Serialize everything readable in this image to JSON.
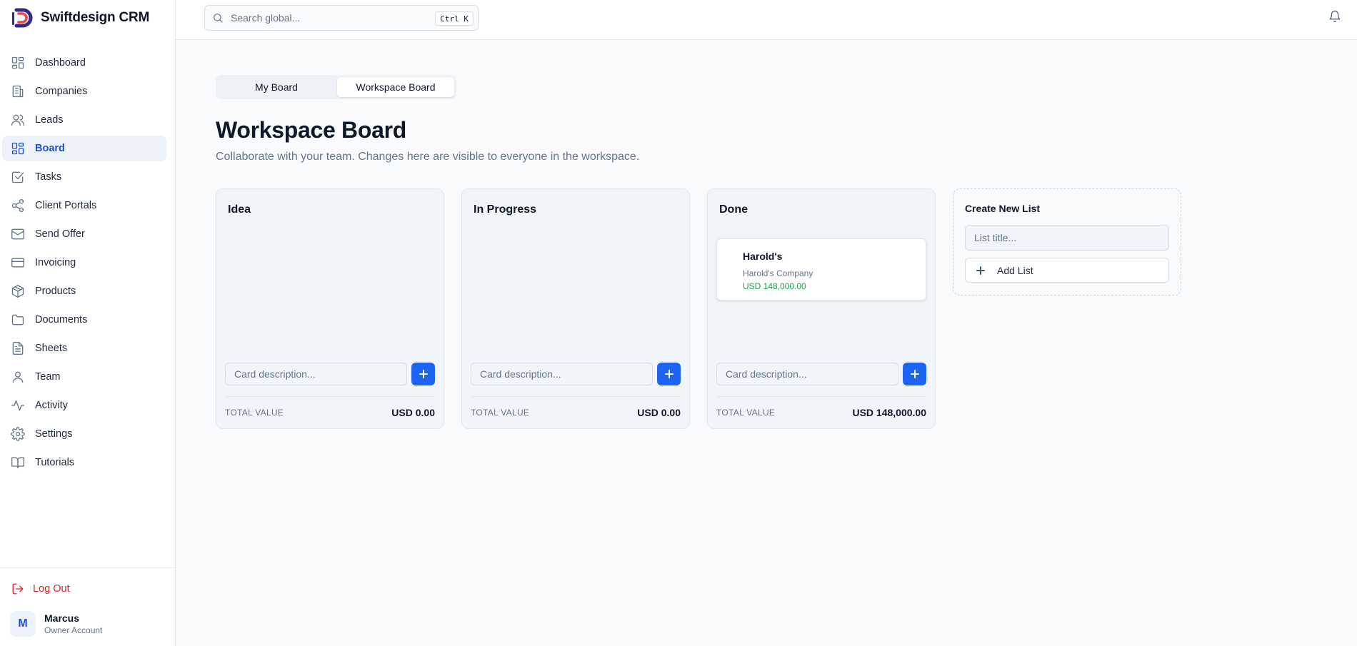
{
  "app": {
    "name": "Swiftdesign CRM",
    "accent": "#1d4ed8",
    "button_color": "#1d64f2"
  },
  "sidebar": {
    "items": [
      {
        "label": "Dashboard",
        "icon": "dashboard-icon"
      },
      {
        "label": "Companies",
        "icon": "building-icon"
      },
      {
        "label": "Leads",
        "icon": "users-icon"
      },
      {
        "label": "Board",
        "icon": "board-icon",
        "active": true
      },
      {
        "label": "Tasks",
        "icon": "checkbox-icon"
      },
      {
        "label": "Client Portals",
        "icon": "share-icon"
      },
      {
        "label": "Send Offer",
        "icon": "mail-icon"
      },
      {
        "label": "Invoicing",
        "icon": "credit-card-icon"
      },
      {
        "label": "Products",
        "icon": "package-icon"
      },
      {
        "label": "Documents",
        "icon": "folder-icon"
      },
      {
        "label": "Sheets",
        "icon": "file-text-icon"
      },
      {
        "label": "Team",
        "icon": "user-icon"
      },
      {
        "label": "Activity",
        "icon": "activity-icon"
      },
      {
        "label": "Settings",
        "icon": "gear-icon"
      },
      {
        "label": "Tutorials",
        "icon": "book-icon"
      }
    ],
    "logout_label": "Log Out",
    "user": {
      "initial": "M",
      "name": "Marcus",
      "role": "Owner Account"
    }
  },
  "topbar": {
    "search_placeholder": "Search global...",
    "shortcut": "Ctrl K"
  },
  "main": {
    "tabs": [
      {
        "label": "My Board",
        "active": false
      },
      {
        "label": "Workspace Board",
        "active": true
      }
    ],
    "title": "Workspace Board",
    "subtitle": "Collaborate with your team. Changes here are visible to everyone in the workspace.",
    "lists": [
      {
        "title": "Idea",
        "card_placeholder": "Card description...",
        "total_label": "TOTAL VALUE",
        "total_value": "USD 0.00",
        "cards": []
      },
      {
        "title": "In Progress",
        "card_placeholder": "Card description...",
        "total_label": "TOTAL VALUE",
        "total_value": "USD 0.00",
        "cards": []
      },
      {
        "title": "Done",
        "card_placeholder": "Card description...",
        "total_label": "TOTAL VALUE",
        "total_value": "USD 148,000.00",
        "cards": [
          {
            "title": "Harold's",
            "company": "Harold's Company",
            "amount": "USD 148,000.00"
          }
        ]
      }
    ],
    "new_list": {
      "title": "Create New List",
      "placeholder": "List title...",
      "button_label": "Add List"
    }
  }
}
